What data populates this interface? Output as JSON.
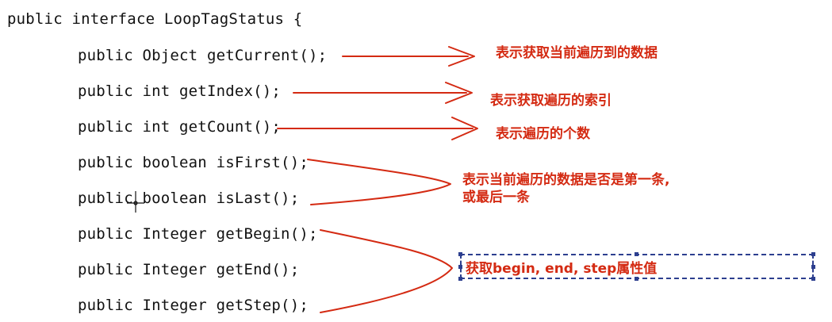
{
  "code": {
    "header": "public interface LoopTagStatus {",
    "methods": [
      "public Object getCurrent();",
      "public int getIndex();",
      "public int getCount();",
      "public boolean isFirst();",
      "public boolean isLast();",
      "public Integer getBegin();",
      "public Integer getEnd();",
      "public Integer getStep();"
    ]
  },
  "annotations": {
    "current": "表示获取当前遍历到的数据",
    "index": "表示获取遍历的索引",
    "count": "表示遍历的个数",
    "first_last_line1": "表示当前遍历的数据是否是第一条,",
    "first_last_line2": "或最后一条",
    "begin_end_step": "获取begin, end, step属性值"
  },
  "colors": {
    "annotation": "#d42a12",
    "selection_box": "#2d3f8f"
  }
}
